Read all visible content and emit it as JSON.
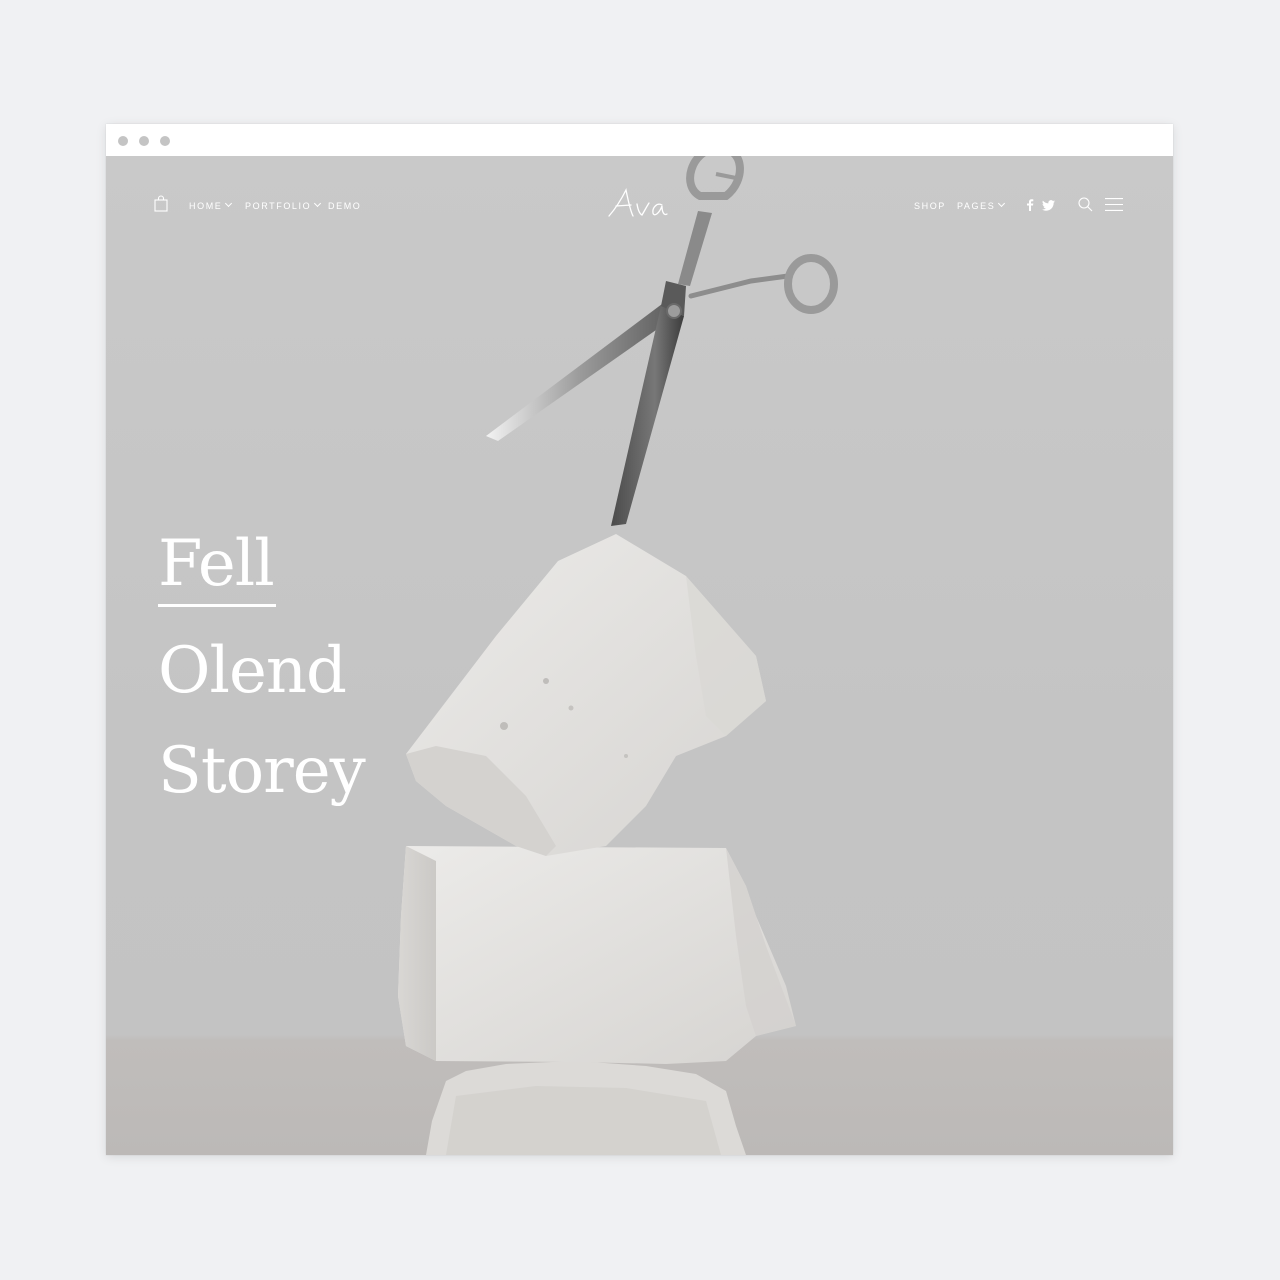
{
  "window": {
    "controls": [
      "window-dot",
      "window-dot",
      "window-dot"
    ]
  },
  "nav": {
    "left": [
      {
        "label": "HOME",
        "has_dropdown": true
      },
      {
        "label": "PORTFOLIO",
        "has_dropdown": true
      },
      {
        "label": "DEMO",
        "has_dropdown": false
      }
    ],
    "logo_text": "Ava",
    "right": [
      {
        "label": "SHOP",
        "has_dropdown": false
      },
      {
        "label": "PAGES",
        "has_dropdown": true
      }
    ],
    "icons": [
      "shopping-bag-icon",
      "facebook-icon",
      "twitter-icon",
      "search-icon",
      "menu-icon"
    ]
  },
  "hero": {
    "lines": [
      "Fell",
      "Olend",
      "Storey"
    ],
    "image_subject": "scissors-on-stacked-stones"
  },
  "colors": {
    "page_bg": "#f0f1f3",
    "hero_bg": "#c6c6c6",
    "text": "#ffffff"
  }
}
